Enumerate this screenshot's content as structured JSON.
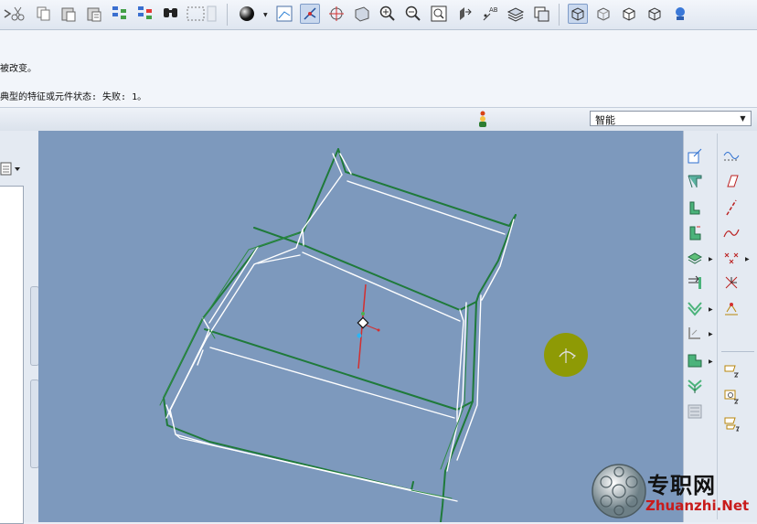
{
  "toolbar": {
    "icons": [
      "partial-arrow-icon",
      "scissors-icon",
      "copy-icon",
      "paste-icon",
      "paste-special-icon",
      "regenerate-icon",
      "regenerate-manager-icon",
      "find-icon",
      "selection-box-icon",
      "sphere-display-icon",
      "sketch-plane-icon",
      "datum-display-icon",
      "spin-center-icon",
      "orient-icon",
      "zoom-in-icon",
      "zoom-out-icon",
      "refit-icon",
      "repaint-icon",
      "annotation-display-icon",
      "layers-icon",
      "saved-views-icon",
      "shading-edges-icon",
      "wireframe-icon",
      "hidden-line-icon",
      "no-hidden-icon",
      "shading-icon",
      "model-tree-icon"
    ]
  },
  "messages": {
    "line1": "被改变。",
    "line2": "典型的特征或元件状态: 失败: 1。"
  },
  "status": {
    "filter_value": "智能"
  },
  "right_toolbar": {
    "icons": [
      "plane-icon",
      "curve-datum-icon",
      "round-icon",
      "sketched-datum-icon",
      "extrude-icon",
      "axis-icon",
      "revolve-icon",
      "spline-icon",
      "shell-icon",
      "point-icon",
      "draft-icon",
      "csys-icon",
      "mirror-icon",
      "analysis-icon",
      "rib-icon",
      "annotation-icon",
      "pattern-icon",
      "view-manager-icon",
      "merge-icon",
      "layer-tree-icon"
    ]
  },
  "watermark": {
    "cn_text": "专职网",
    "url_text": "Zhuanzhi.Net"
  }
}
